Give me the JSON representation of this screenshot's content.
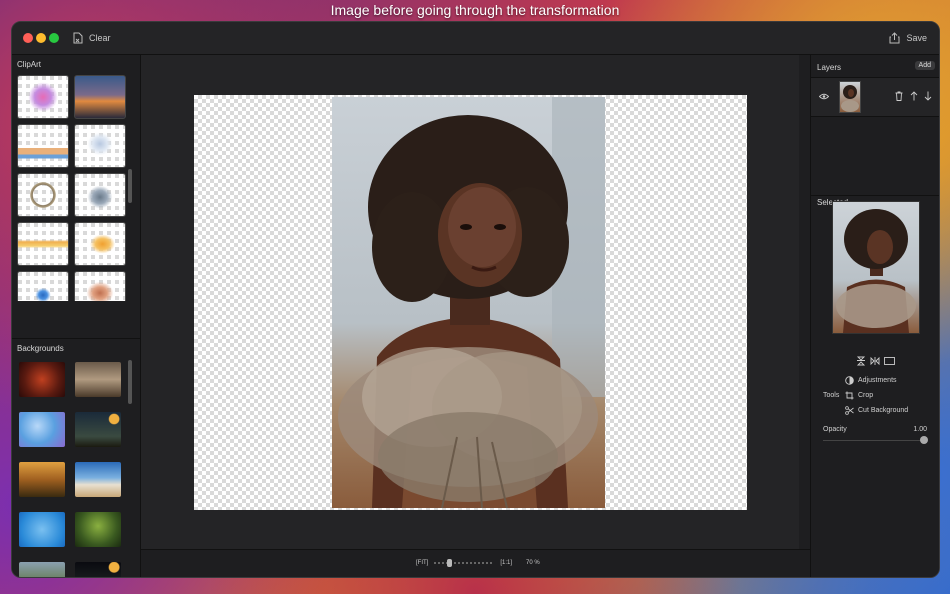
{
  "caption": "Image before going through the transformation",
  "toolbar": {
    "clear_label": "Clear",
    "save_label": "Save"
  },
  "clipart": {
    "title": "ClipArt"
  },
  "backgrounds": {
    "title": "Backgrounds"
  },
  "zoom": {
    "fit_label": "[FIT]",
    "one_label": "[1:1]",
    "value": "70 %",
    "level": 0.25
  },
  "layers": {
    "title": "Layers",
    "add_label": "Add"
  },
  "selected": {
    "title": "Selected",
    "tools_label": "Tools",
    "adjustments_label": "Adjustments",
    "crop_label": "Crop",
    "cut_background_label": "Cut Background",
    "opacity_label": "Opacity",
    "opacity_value": "1.00",
    "opacity_level": 1.0
  },
  "colors": {
    "window_bg": "#1e1e20",
    "panel_bg": "#242426",
    "text": "#d8d8d8"
  }
}
